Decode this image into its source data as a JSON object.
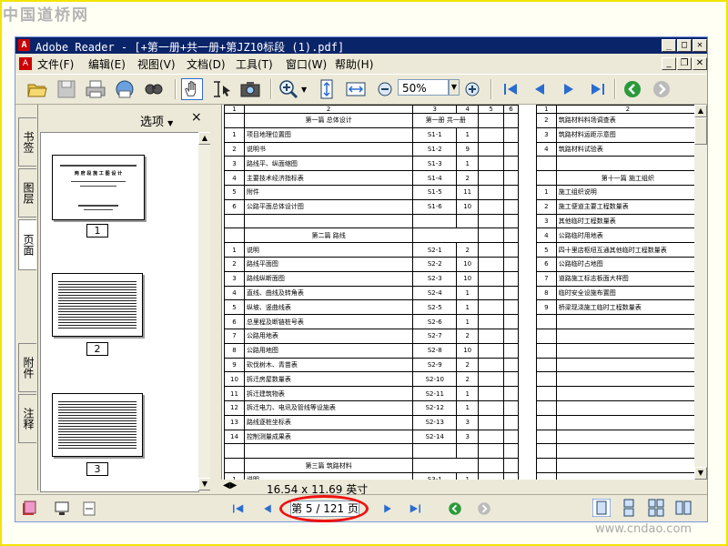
{
  "watermarks": {
    "top": "中国道桥网",
    "bottom": "www.cndao.com"
  },
  "window": {
    "app_icon": "adobe-reader-icon",
    "title": "Adobe Reader - [+第一册+共一册+第JZ10标段 (1).pdf]"
  },
  "menu": [
    {
      "label": "文件(F)"
    },
    {
      "label": "编辑(E)"
    },
    {
      "label": "视图(V)"
    },
    {
      "label": "文档(D)"
    },
    {
      "label": "工具(T)"
    },
    {
      "label": "窗口(W)"
    },
    {
      "label": "帮助(H)"
    }
  ],
  "toolbar": {
    "zoom_value": "50%",
    "icons": [
      "open-icon",
      "save-icon",
      "print-icon",
      "email-icon",
      "search-icon",
      "hand-tool-icon",
      "select-text-icon",
      "snapshot-icon",
      "zoom-in-tool-icon",
      "fit-page-icon",
      "fit-width-icon",
      "zoom-out-icon",
      "zoom-in-icon",
      "first-page-icon",
      "prev-page-icon",
      "next-page-icon",
      "last-page-icon",
      "go-back-icon",
      "go-forward-icon"
    ]
  },
  "side_tabs": [
    "书签",
    "图层",
    "页面",
    "附件",
    "注释"
  ],
  "panel": {
    "options_label": "选项",
    "close": "×",
    "thumbnails": [
      {
        "page": "1",
        "title": "两 府 段 施 工 图 设 计"
      },
      {
        "page": "2"
      },
      {
        "page": "3"
      }
    ]
  },
  "document": {
    "left_header": [
      "1",
      "2",
      "3",
      "4",
      "5",
      "6"
    ],
    "left_rows": [
      {
        "type": "section",
        "name": "第一篇 总体设计",
        "volume": "第一册  共一册"
      },
      {
        "no": "1",
        "name": "项目地理位置图",
        "code": "S1-1",
        "n": "1"
      },
      {
        "no": "2",
        "name": "说明书",
        "code": "S1-2",
        "n": "9"
      },
      {
        "no": "3",
        "name": "路线平、纵面缩图",
        "code": "S1-3",
        "n": "1"
      },
      {
        "no": "4",
        "name": "主要技术经济指标表",
        "code": "S1-4",
        "n": "2"
      },
      {
        "no": "5",
        "name": "附件",
        "code": "S1-5",
        "n": "11"
      },
      {
        "no": "6",
        "name": "公路平面总体设计图",
        "code": "S1-6",
        "n": "10"
      },
      {
        "type": "blank"
      },
      {
        "type": "section",
        "name": "第二篇 路线",
        "volume": ""
      },
      {
        "no": "1",
        "name": "说明",
        "code": "S2-1",
        "n": "2"
      },
      {
        "no": "2",
        "name": "路线平面图",
        "code": "S2-2",
        "n": "10"
      },
      {
        "no": "3",
        "name": "路线纵断面图",
        "code": "S2-3",
        "n": "10"
      },
      {
        "no": "4",
        "name": "直线、曲线及转角表",
        "code": "S2-4",
        "n": "1"
      },
      {
        "no": "5",
        "name": "纵坡、竖曲线表",
        "code": "S2-5",
        "n": "1"
      },
      {
        "no": "6",
        "name": "总里程及断链桩号表",
        "code": "S2-6",
        "n": "1"
      },
      {
        "no": "7",
        "name": "公路用地表",
        "code": "S2-7",
        "n": "2"
      },
      {
        "no": "8",
        "name": "公路用地图",
        "code": "S2-8",
        "n": "10"
      },
      {
        "no": "9",
        "name": "砍伐树木、青苗表",
        "code": "S2-9",
        "n": "2"
      },
      {
        "no": "10",
        "name": "拆迁房屋数量表",
        "code": "S2-10",
        "n": "2"
      },
      {
        "no": "11",
        "name": "拆迁建筑物表",
        "code": "S2-11",
        "n": "1"
      },
      {
        "no": "12",
        "name": "拆迁电力、电讯及管线等设施表",
        "code": "S2-12",
        "n": "1"
      },
      {
        "no": "13",
        "name": "路线逐桩坐标表",
        "code": "S2-13",
        "n": "3"
      },
      {
        "no": "14",
        "name": "控制测量成果表",
        "code": "S2-14",
        "n": "3"
      },
      {
        "type": "blank"
      },
      {
        "type": "section",
        "name": "第三篇 筑路材料",
        "volume": ""
      },
      {
        "no": "1",
        "name": "说明",
        "code": "S3-1",
        "n": "1"
      }
    ],
    "right_header": [
      "1",
      "2"
    ],
    "right_rows": [
      {
        "no": "2",
        "name": "筑路材料料场调查表"
      },
      {
        "no": "3",
        "name": "筑路材料运距示意图"
      },
      {
        "no": "4",
        "name": "筑路材料试验表"
      },
      {
        "type": "blank"
      },
      {
        "type": "section",
        "name": "第十一篇 施工组织"
      },
      {
        "no": "1",
        "name": "施工组织说明"
      },
      {
        "no": "2",
        "name": "施工便道主要工程数量表"
      },
      {
        "no": "3",
        "name": "其他临时工程数量表"
      },
      {
        "no": "4",
        "name": "公路临时用地表"
      },
      {
        "no": "5",
        "name": "四十里店枢纽互通其他临时工程数量表"
      },
      {
        "no": "6",
        "name": "公路临时占地图"
      },
      {
        "no": "7",
        "name": "道路施工标志板面大样图"
      },
      {
        "no": "8",
        "name": "临时安全设施布置图"
      },
      {
        "no": "9",
        "name": "桥梁现浇施工临时工程数量表"
      }
    ],
    "right_blank_rows": 12
  },
  "status": {
    "page_size": "16.54 x 11.69 英寸"
  },
  "navigation": {
    "page_display": "第 5 / 121 页",
    "current_page": 5,
    "total_pages": 121
  },
  "colors": {
    "titlebar": "#0a246a",
    "highlight": "#e11111",
    "frame": "#f2e400"
  }
}
